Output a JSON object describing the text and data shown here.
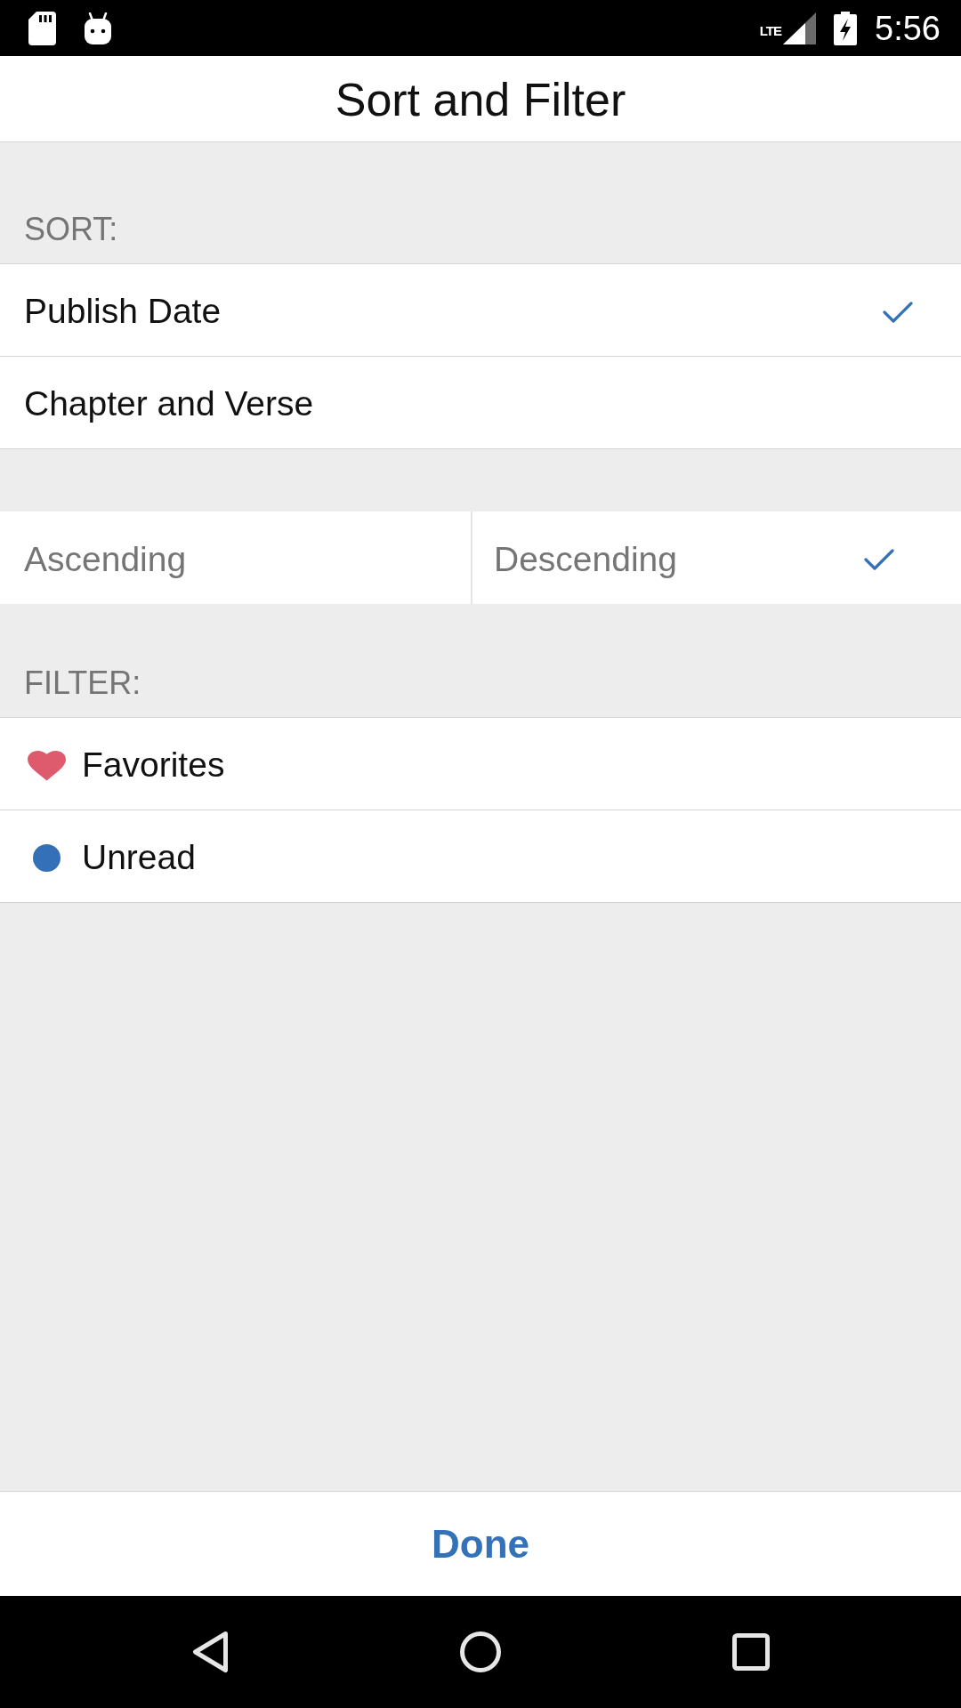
{
  "status_bar": {
    "network": "LTE",
    "time": "5:56"
  },
  "title": "Sort and Filter",
  "sort": {
    "heading": "SORT:",
    "options": [
      {
        "label": "Publish Date",
        "selected": true
      },
      {
        "label": "Chapter and Verse",
        "selected": false
      }
    ],
    "order": [
      {
        "label": "Ascending",
        "selected": false
      },
      {
        "label": "Descending",
        "selected": true
      }
    ]
  },
  "filter": {
    "heading": "FILTER:",
    "items": [
      {
        "kind": "heart",
        "label": "Favorites",
        "color": "#de5b6e",
        "selected": false
      },
      {
        "kind": "dot",
        "label": "Unread",
        "color": "#3470b7",
        "selected": false
      }
    ]
  },
  "done_button": {
    "label": "Done"
  }
}
